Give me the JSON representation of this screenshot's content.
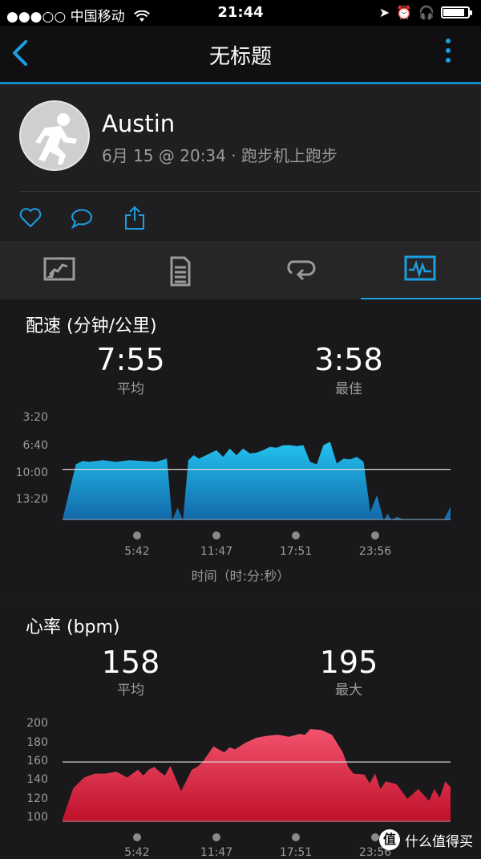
{
  "status_bar": {
    "carrier": "●●●○○ 中国移动",
    "time": "21:44",
    "battery_level": 0.85
  },
  "nav": {
    "title": "无标题"
  },
  "activity": {
    "user_name": "Austin",
    "meta": "6月 15 @ 20:34 · 跑步机上跑步"
  },
  "actions": [
    "heart-icon",
    "comment-icon",
    "share-icon"
  ],
  "tabs": [
    {
      "name": "map-chart-icon",
      "active": false
    },
    {
      "name": "details-list-icon",
      "active": false
    },
    {
      "name": "laps-loop-icon",
      "active": false
    },
    {
      "name": "charts-icon",
      "active": true
    }
  ],
  "pace": {
    "title": "配速 (分钟/公里)",
    "avg_value": "7:55",
    "avg_label": "平均",
    "best_value": "3:58",
    "best_label": "最佳",
    "x_axis_label": "时间（时:分:秒）"
  },
  "heart_rate": {
    "title": "心率 (bpm)",
    "avg_value": "158",
    "avg_label": "平均",
    "max_value": "195",
    "max_label": "最大"
  },
  "chart_data": [
    {
      "type": "area",
      "x_ticks": [
        "5:42",
        "11:47",
        "17:51",
        "23:56"
      ],
      "y_ticks": [
        "3:20",
        "6:40",
        "10:00",
        "13:20"
      ],
      "color": "#1ab0e6",
      "x": [
        0,
        1,
        1.5,
        2,
        3,
        4,
        5,
        6,
        7,
        7.8,
        8.2,
        8.6,
        9,
        9.4,
        9.8,
        10.2,
        11,
        11.5,
        12,
        12.5,
        13,
        13.5,
        14,
        14.5,
        15,
        15.5,
        16,
        16.5,
        17,
        17.5,
        18,
        18.5,
        19,
        19.5,
        20,
        20.5,
        21,
        21.5,
        22,
        22.5,
        23,
        23.5,
        24,
        24.3,
        24.6,
        25,
        25.5,
        26,
        26.5,
        27,
        27.5,
        28,
        28.5,
        29
      ],
      "y": [
        14.9,
        8.3,
        7.9,
        8.0,
        7.8,
        8.0,
        7.8,
        7.9,
        8.0,
        7.6,
        15.0,
        13.5,
        15.0,
        7.8,
        7.2,
        7.6,
        7.0,
        6.6,
        7.4,
        6.4,
        7.2,
        6.4,
        7.0,
        6.9,
        6.6,
        6.2,
        6.3,
        6.0,
        6.0,
        6.1,
        6.0,
        8.0,
        8.3,
        6.0,
        5.6,
        8.2,
        7.6,
        7.7,
        7.4,
        8.0,
        14.0,
        12.0,
        15.0,
        14.2,
        15.0,
        14.6,
        14.9,
        14.9,
        14.9,
        14.9,
        14.9,
        14.9,
        14.9,
        13.4
      ],
      "reference_line": 8.9,
      "ylim": [
        2,
        15
      ]
    },
    {
      "type": "area",
      "x_ticks": [
        "5:42",
        "11:47",
        "17:51",
        "23:56"
      ],
      "y_ticks": [
        "200",
        "180",
        "160",
        "140",
        "120",
        "100"
      ],
      "color": "#e0243f",
      "x": [
        0,
        1,
        2,
        3,
        4,
        5,
        6,
        7,
        7.5,
        8,
        8.5,
        9,
        9.5,
        10,
        11,
        12,
        12.5,
        13,
        14,
        15,
        15.5,
        16,
        17,
        18,
        19,
        20,
        21,
        22,
        22.5,
        23,
        24,
        25,
        26,
        26.5,
        27,
        28,
        28.5,
        29,
        29.5,
        30,
        31,
        32,
        33,
        34,
        34.5,
        35,
        35.5,
        36
      ],
      "y": [
        101,
        133,
        144,
        148,
        148,
        150,
        144,
        152,
        146,
        152,
        155,
        150,
        146,
        156,
        130,
        152,
        155,
        160,
        176,
        170,
        175,
        173,
        180,
        185,
        187,
        188,
        186,
        189,
        188,
        194,
        193,
        188,
        170,
        155,
        148,
        147,
        138,
        148,
        132,
        140,
        137,
        122,
        132,
        120,
        132,
        123,
        140,
        134
      ],
      "reference_line": 160,
      "ylim": [
        98,
        204
      ]
    }
  ],
  "watermark": {
    "badge": "值",
    "text": "什么值得买"
  }
}
